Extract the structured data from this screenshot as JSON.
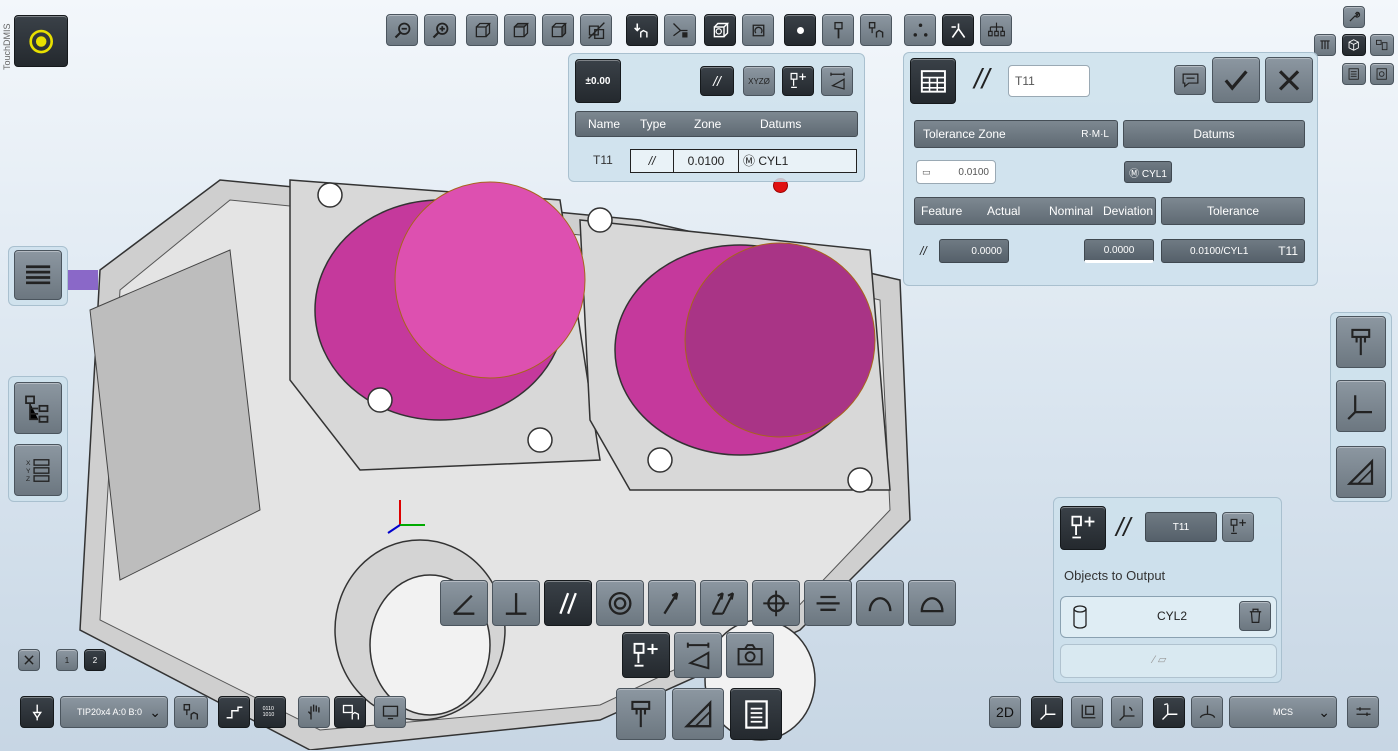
{
  "app": {
    "brand": "TouchDMIS"
  },
  "colors": {
    "accent_yellow": "#e8e000",
    "magenta": "#d02a8c",
    "button_grey": "#7d8891",
    "panel": "#cde1ec"
  },
  "tolerance_table": {
    "headers": [
      "Name",
      "Type",
      "Zone",
      "Datums"
    ],
    "row": {
      "name": "T11",
      "type": "//",
      "zone": "0.0100",
      "datum": "Ⓜ CYL1"
    },
    "title_icon": "±0.00"
  },
  "tolerance_editor": {
    "symbol": "//",
    "name_value": "T11",
    "tolerance_zone_label": "Tolerance Zone",
    "rml_label": "R·M·L",
    "datums_label": "Datums",
    "zone_value": "0.0100",
    "datum_value": "Ⓜ CYL1",
    "cols": [
      "Feature",
      "Actual",
      "Nominal",
      "Deviation"
    ],
    "tolerance_label": "Tolerance",
    "feature_symbol": "//",
    "actual_value": "0.0000",
    "deviation_value": "0.0000",
    "tolerance_value": "0.0100/CYL1",
    "tolerance_name": "T11"
  },
  "output_panel": {
    "symbol": "//",
    "name": "T11",
    "objects_label": "Objects to Output",
    "object_name": "CYL2"
  },
  "bottom_bar": {
    "probe_value": "TIP20x4 A:0 B:0",
    "view_2d": "2D",
    "coord_system": "MCS"
  },
  "small_icons": {
    "one_label": "1",
    "two_label": "2"
  }
}
